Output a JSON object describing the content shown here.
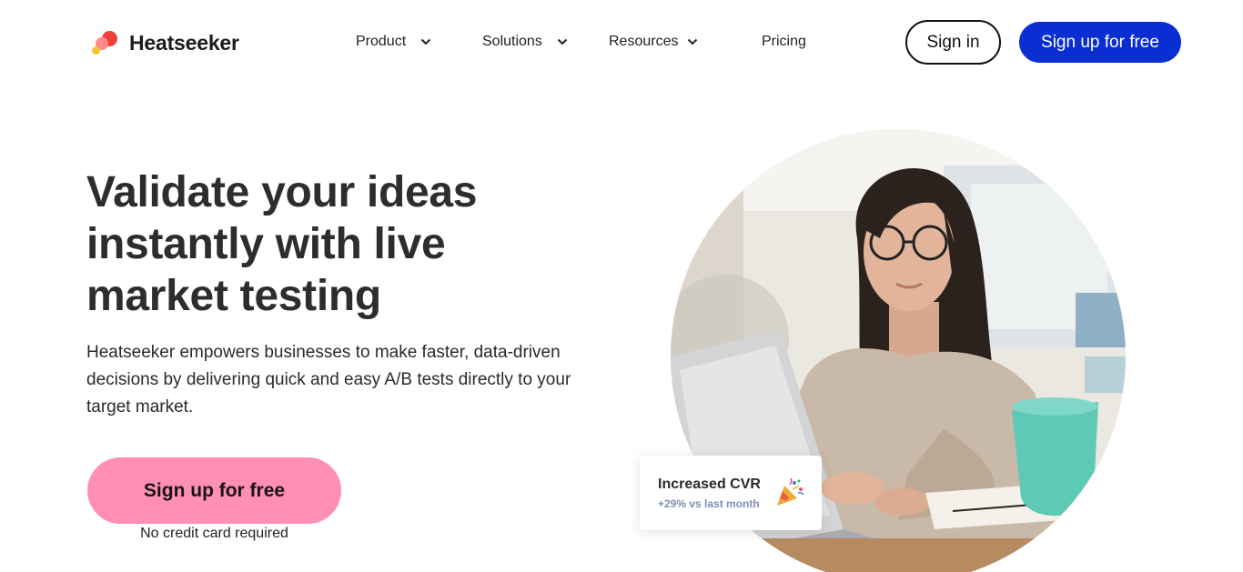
{
  "brand": {
    "name": "Heatseeker"
  },
  "nav": {
    "items": [
      {
        "label": "Product",
        "has_menu": true
      },
      {
        "label": "Solutions",
        "has_menu": true
      },
      {
        "label": "Resources",
        "has_menu": true
      },
      {
        "label": "Pricing",
        "has_menu": false
      }
    ],
    "signin_label": "Sign in",
    "signup_label": "Sign up for free"
  },
  "hero": {
    "title": "Validate your ideas instantly with live market testing",
    "description": "Heatseeker empowers businesses to make faster, data-driven decisions by delivering quick and easy A/B tests directly to your target market.",
    "cta_label": "Sign up for free",
    "cta_note": "No credit card required"
  },
  "stat_card": {
    "title": "Increased CVR",
    "subtitle": "+29% vs last month",
    "icon": "party-popper-icon"
  },
  "colors": {
    "primary_blue": "#0a2ed1",
    "cta_pink": "#ff8fb5",
    "stat_subtitle": "#7d8fb8",
    "logo_red": "#ef3f3a",
    "logo_pink": "#ff8a8a",
    "logo_yellow": "#f5c431"
  }
}
